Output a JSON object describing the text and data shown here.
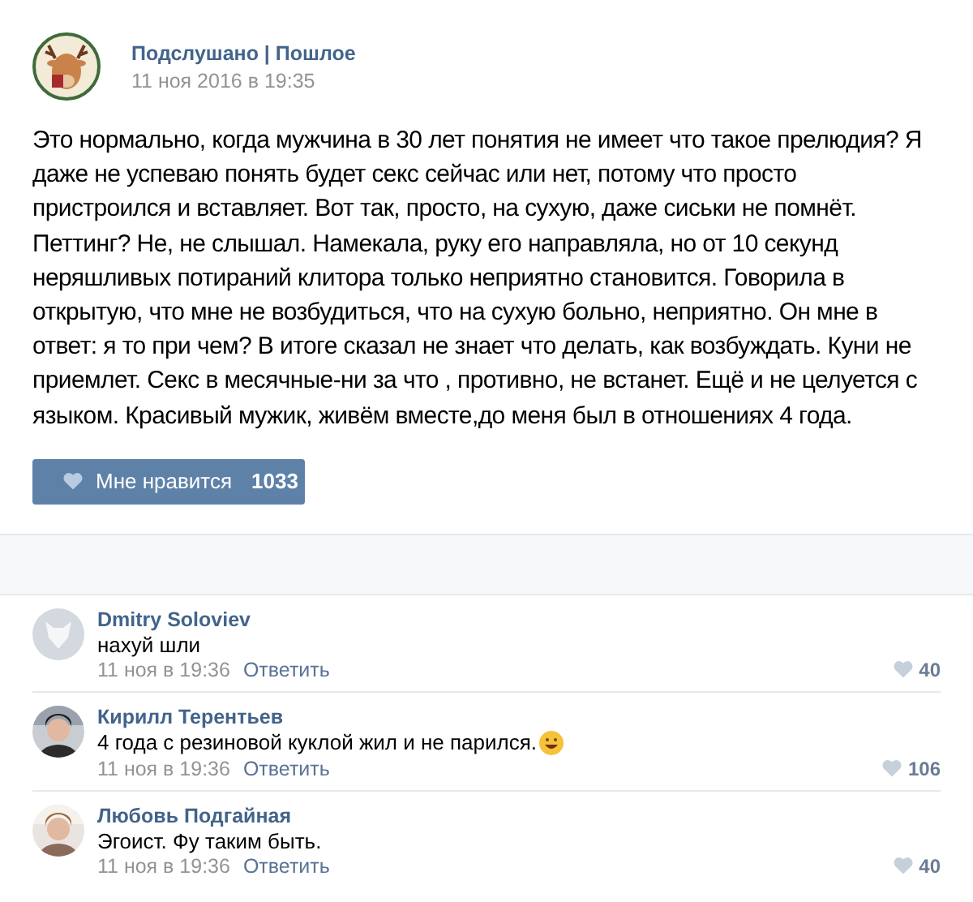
{
  "post": {
    "author": "Подслушано | Пошлое",
    "date": "11 ноя 2016 в 19:35",
    "text": "Это нормально, когда мужчина в 30 лет понятия не имеет что такое прелюдия? Я даже не успеваю понять будет секс сейчас или нет, потому что просто пристроился и вставляет. Вот так, просто, на сухую, даже сиськи не помнёт. Петтинг? Не, не слышал. Намекала, руку его направляла, но от 10 секунд неряшливых потираний клитора только неприятно становится. Говорила в открытую, что мне не возбудиться, что на сухую больно, неприятно. Он мне в ответ: я то при чем? В итоге сказал не знает что делать, как возбуждать. Куни не приемлет. Секс в месячные-ни за что , противно, не встанет. Ещё и не целуется с языком. Красивый мужик, живём вместе,до меня был в отношениях 4 года.",
    "like": {
      "label": "Мне нравится",
      "count": "1033"
    }
  },
  "comments": [
    {
      "avatar": {
        "kind": "default"
      },
      "name": "Dmitry Soloviev",
      "text": "нахуй шли",
      "emoji": false,
      "date": "11 ноя в 19:36",
      "reply": "Ответить",
      "likes": "40"
    },
    {
      "name": "Кирилл Терентьев",
      "text": "4 года с резиновой куклой жил и не парился.",
      "emoji": true,
      "date": "11 ноя в 19:36",
      "reply": "Ответить",
      "likes": "106"
    },
    {
      "name": "Любовь Подгайная",
      "text": "Эгоист. Фу таким быть.",
      "emoji": false,
      "date": "11 ноя в 19:36",
      "reply": "Ответить",
      "likes": "40"
    }
  ]
}
